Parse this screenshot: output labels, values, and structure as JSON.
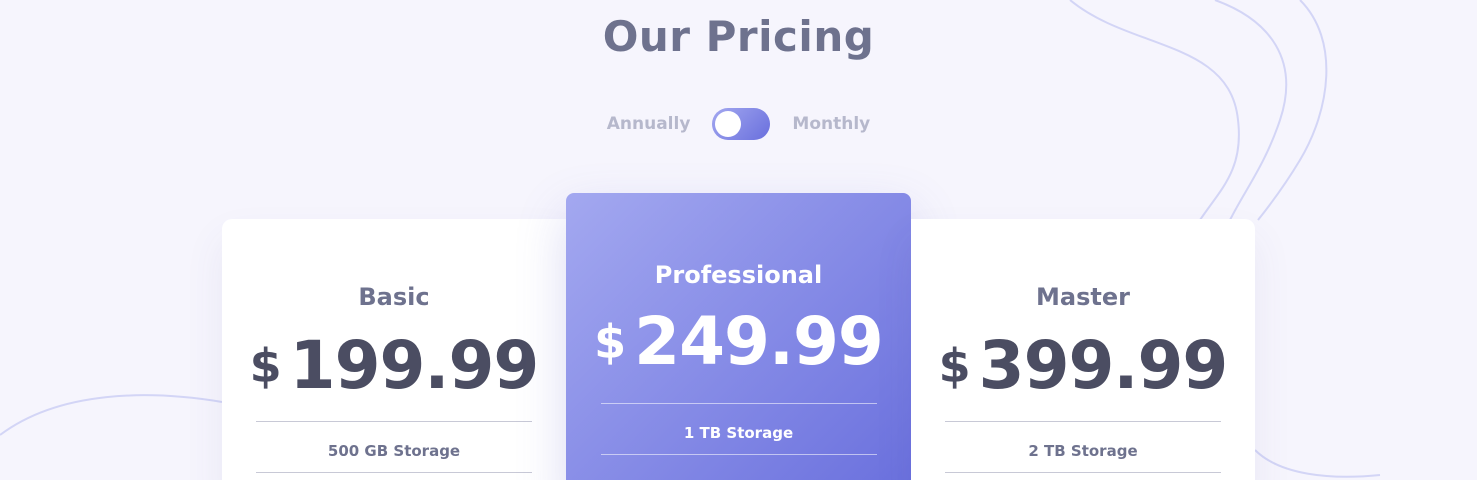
{
  "page": {
    "title": "Our Pricing"
  },
  "billing_toggle": {
    "left_label": "Annually",
    "right_label": "Monthly"
  },
  "plans": [
    {
      "name": "Basic",
      "currency": "$",
      "price": "199.99",
      "features": [
        "500 GB Storage"
      ]
    },
    {
      "name": "Professional",
      "currency": "$",
      "price": "249.99",
      "features": [
        "1 TB Storage"
      ]
    },
    {
      "name": "Master",
      "currency": "$",
      "price": "399.99",
      "features": [
        "2 TB Storage"
      ]
    }
  ],
  "colors": {
    "background": "#f6f5fd",
    "text_primary": "#4b4d62",
    "text_secondary": "#6e728e",
    "toggle_label": "#b6b8cc",
    "gradient_start": "#a3a8f0",
    "gradient_end": "#696fdd"
  }
}
